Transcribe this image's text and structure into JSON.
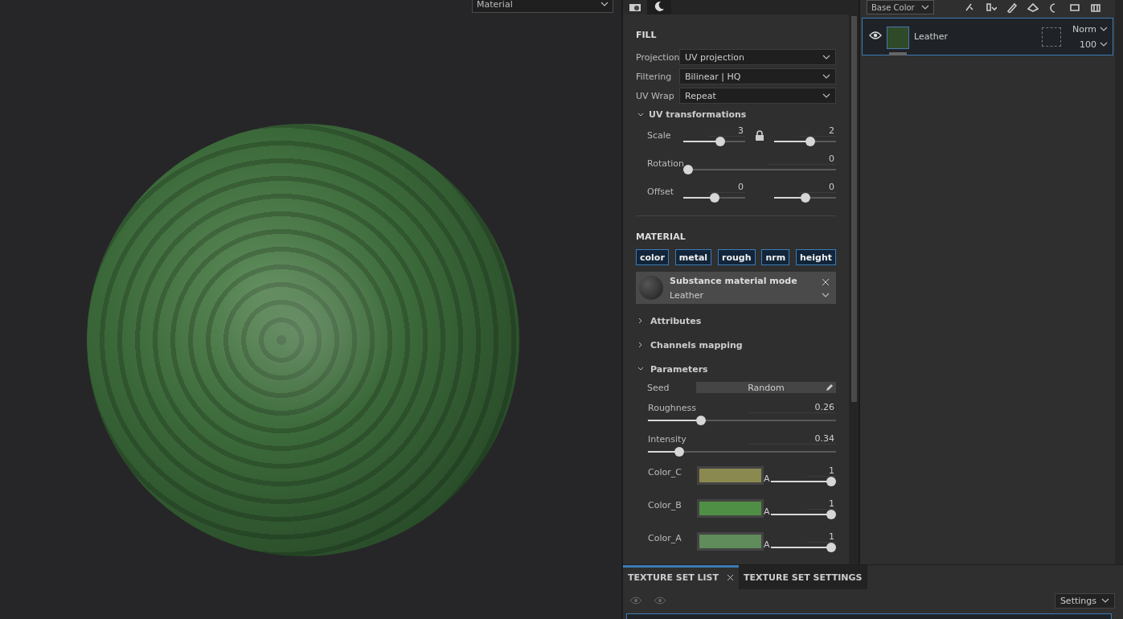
{
  "viewport": {
    "mode_dropdown": "Material"
  },
  "properties": {
    "tabs": [
      {
        "kind": "camera",
        "selected": false
      },
      {
        "kind": "moon",
        "selected": true
      }
    ],
    "fill": {
      "title": "FILL",
      "fields": [
        {
          "label": "Projection",
          "value": "UV projection"
        },
        {
          "label": "Filtering",
          "value": "Bilinear | HQ"
        },
        {
          "label": "UV Wrap",
          "value": "Repeat"
        }
      ],
      "uv_transformations": {
        "title": "UV transformations",
        "expanded": true,
        "locked": true,
        "rows": [
          {
            "label": "Scale",
            "sliders": [
              {
                "reading": "3",
                "level": 0.62
              },
              {
                "reading": "2",
                "level": 0.6
              }
            ]
          },
          {
            "label": "Rotation",
            "sliders": [
              {
                "reading": "0",
                "level": 0
              }
            ]
          },
          {
            "label": "Offset",
            "sliders": [
              {
                "reading": "0",
                "level": 0.5
              },
              {
                "reading": "0",
                "level": 0.5
              }
            ]
          }
        ]
      }
    },
    "material": {
      "title": "MATERIAL",
      "channels": [
        {
          "label": "color",
          "on": true
        },
        {
          "label": "metal",
          "on": true
        },
        {
          "label": "rough",
          "on": true
        },
        {
          "label": "nrm",
          "on": true
        },
        {
          "label": "height",
          "on": true
        }
      ],
      "substance": {
        "title": "Substance material mode",
        "value": "Leather"
      },
      "sections": [
        {
          "title": "Attributes",
          "expanded": false
        },
        {
          "title": "Channels mapping",
          "expanded": false
        },
        {
          "title": "Parameters",
          "expanded": true
        }
      ],
      "seed": {
        "label": "Seed",
        "value": "Random"
      },
      "sliders": [
        {
          "label": "Roughness",
          "reading": "0.26",
          "level": 0.27
        },
        {
          "label": "Intensity",
          "reading": "0.34",
          "level": 0.15
        }
      ],
      "colors": [
        {
          "label": "Color_C",
          "color": "#8a8a50",
          "alpha_label": "A",
          "reading": "1",
          "level": 1
        },
        {
          "label": "Color_B",
          "color": "#4f8f45",
          "alpha_label": "A",
          "reading": "1",
          "level": 1
        },
        {
          "label": "Color_A",
          "color": "#5f8c5a",
          "alpha_label": "A",
          "reading": "1",
          "level": 1
        }
      ]
    }
  },
  "layers": {
    "channel_dropdown": "Base Color",
    "items": [
      {
        "name": "Leather",
        "visible": true,
        "selected": true,
        "blend": "Norm",
        "opacity": "100"
      }
    ]
  },
  "bottom": {
    "tabs": [
      {
        "label": "TEXTURE SET LIST",
        "selected": true,
        "closable": true
      },
      {
        "label": "TEXTURE SET SETTINGS",
        "selected": false,
        "closable": false
      }
    ],
    "settings": "Settings"
  }
}
